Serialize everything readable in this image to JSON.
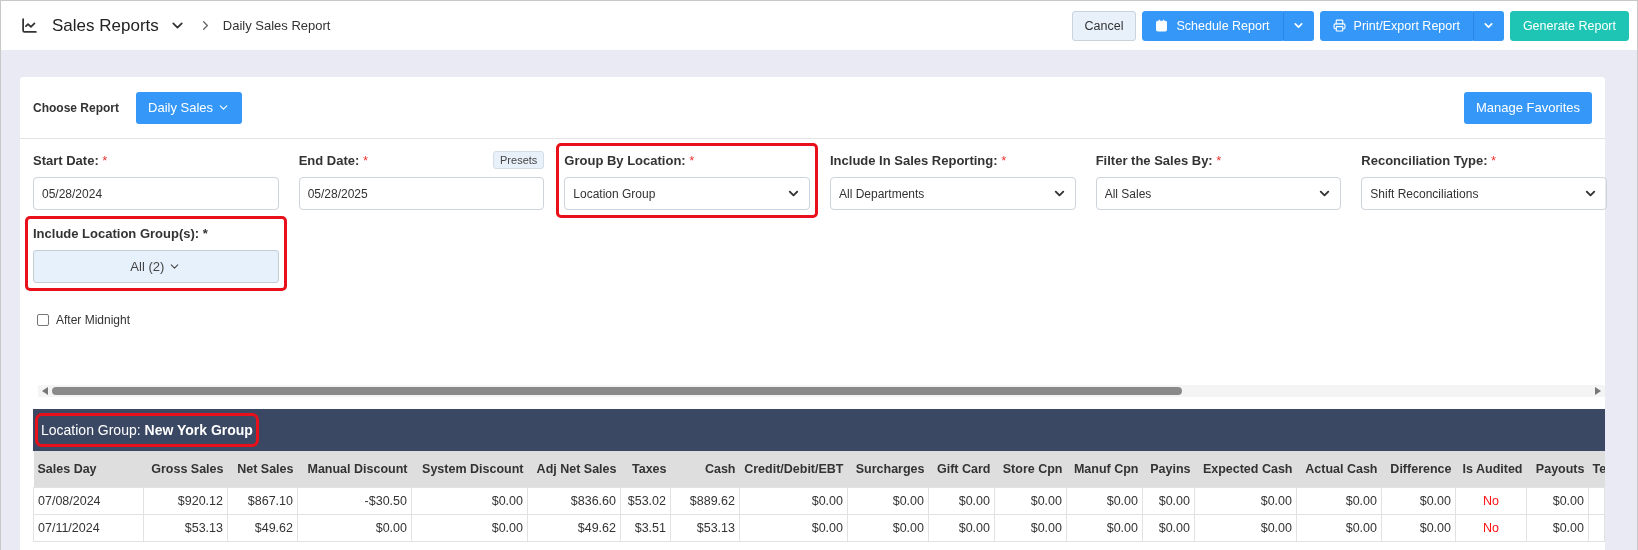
{
  "header": {
    "title": "Sales Reports",
    "breadcrumb": "Daily Sales Report",
    "cancel": "Cancel",
    "schedule": "Schedule Report",
    "export": "Print/Export Report",
    "generate": "Generate Report"
  },
  "report_bar": {
    "label": "Choose Report",
    "value": "Daily Sales",
    "manage": "Manage Favorites"
  },
  "filters": [
    {
      "kind": "date",
      "label": "Start Date:",
      "required": "*",
      "value": "05/28/2024",
      "highlighted": false
    },
    {
      "kind": "date",
      "label": "End Date:",
      "required": "*",
      "value": "05/28/2025",
      "presets": "Presets",
      "highlighted": false
    },
    {
      "kind": "select",
      "label": "Group By Location:",
      "required": "*",
      "value": "Location Group",
      "highlighted": true
    },
    {
      "kind": "select",
      "label": "Include In Sales Reporting:",
      "required": "*",
      "value": "All Departments",
      "highlighted": false
    },
    {
      "kind": "select",
      "label": "Filter the Sales By:",
      "required": "*",
      "value": "All Sales",
      "highlighted": false
    },
    {
      "kind": "select",
      "label": "Reconciliation Type:",
      "required": "*",
      "value": "Shift Reconciliations",
      "highlighted": false
    },
    {
      "kind": "multiselect",
      "label": "Include Location Group(s): *",
      "value": "All (2)",
      "highlighted": true
    }
  ],
  "after_midnight": {
    "label": "After Midnight",
    "checked": false
  },
  "group": {
    "title": "Location Group: **New York Group**",
    "highlighted": true
  },
  "table": {
    "columns": [
      {
        "label": "Sales Day",
        "kind": "text"
      },
      {
        "label": "Gross Sales",
        "kind": "money"
      },
      {
        "label": "Net Sales",
        "kind": "money"
      },
      {
        "label": "Manual Discount",
        "kind": "money"
      },
      {
        "label": "System Discount",
        "kind": "money"
      },
      {
        "label": "Adj Net Sales",
        "kind": "money"
      },
      {
        "label": "Taxes",
        "kind": "money"
      },
      {
        "label": "Cash",
        "kind": "money"
      },
      {
        "label": "Credit/Debit/EBT",
        "kind": "money"
      },
      {
        "label": "Surcharges",
        "kind": "money"
      },
      {
        "label": "Gift Card",
        "kind": "money"
      },
      {
        "label": "Store Cpn",
        "kind": "money"
      },
      {
        "label": "Manuf Cpn",
        "kind": "money"
      },
      {
        "label": "Payins",
        "kind": "money"
      },
      {
        "label": "Expected Cash",
        "kind": "money"
      },
      {
        "label": "Actual Cash",
        "kind": "money"
      },
      {
        "label": "Difference",
        "kind": "money"
      },
      {
        "label": "Is Audited",
        "kind": "flag"
      },
      {
        "label": "Payouts",
        "kind": "money"
      },
      {
        "label": "Te",
        "kind": "money"
      }
    ],
    "rows": [
      [
        "07/08/2024",
        "$920.12",
        "$867.10",
        "-$30.50",
        "$0.00",
        "$836.60",
        "$53.02",
        "$889.62",
        "$0.00",
        "$0.00",
        "$0.00",
        "$0.00",
        "$0.00",
        "$0.00",
        "$0.00",
        "$0.00",
        "$0.00",
        "No",
        "$0.00"
      ],
      [
        "07/11/2024",
        "$53.13",
        "$49.62",
        "$0.00",
        "$0.00",
        "$49.62",
        "$3.51",
        "$53.13",
        "$0.00",
        "$0.00",
        "$0.00",
        "$0.00",
        "$0.00",
        "$0.00",
        "$0.00",
        "$0.00",
        "$0.00",
        "No",
        "$0.00"
      ]
    ]
  }
}
